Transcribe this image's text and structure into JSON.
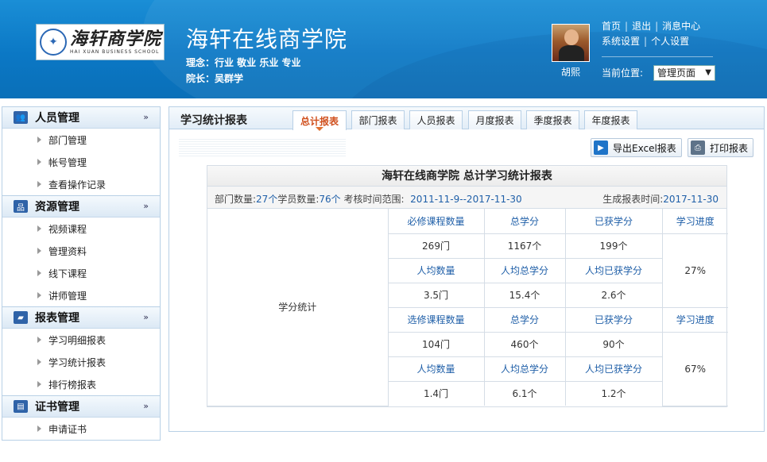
{
  "header": {
    "logo_cn": "海轩商学院",
    "logo_en": "HAI XUAN BUSINESS SCHOOL",
    "site_title": "海轩在线商学院",
    "motto": "理念：行业 敬业 乐业 专业",
    "dean": "院长：吴群学",
    "username": "胡熙",
    "links_row1": [
      "首页",
      "退出",
      "消息中心"
    ],
    "links_row2": [
      "系统设置",
      "个人设置"
    ],
    "position_label": "当前位置:",
    "position_value": "管理页面"
  },
  "sidebar": [
    {
      "title": "人员管理",
      "icon": "users-icon",
      "items": [
        "部门管理",
        "帐号管理",
        "查看操作记录"
      ]
    },
    {
      "title": "资源管理",
      "icon": "sitemap-icon",
      "items": [
        "视频课程",
        "管理资料",
        "线下课程",
        "讲师管理"
      ]
    },
    {
      "title": "报表管理",
      "icon": "folder-icon",
      "items": [
        "学习明细报表",
        "学习统计报表",
        "排行榜报表"
      ]
    },
    {
      "title": "证书管理",
      "icon": "certificate-icon",
      "items": [
        "申请证书"
      ]
    }
  ],
  "panel": {
    "title": "学习统计报表",
    "tabs": [
      "总计报表",
      "部门报表",
      "人员报表",
      "月度报表",
      "季度报表",
      "年度报表"
    ],
    "active_tab": 0,
    "export_label": "导出Excel报表",
    "print_label": "打印报表"
  },
  "report": {
    "title": "海轩在线商学院  总计学习统计报表",
    "dept_label": "部门数量:",
    "dept_value": "27个",
    "student_label": "学员数量:",
    "student_value": "76个",
    "range_label": "考核时间范围:",
    "range_value": "2011-11-9--2017-11-30",
    "gen_label": "生成报表时间:",
    "gen_value": "2017-11-30",
    "row_label": "学分统计",
    "required": {
      "h1": [
        "必修课程数量",
        "总学分",
        "已获学分"
      ],
      "v1": [
        "269门",
        "1167个",
        "199个"
      ],
      "h2": [
        "人均数量",
        "人均总学分",
        "人均已获学分"
      ],
      "v2": [
        "3.5门",
        "15.4个",
        "2.6个"
      ],
      "progress_label": "学习进度",
      "progress_value": "27%"
    },
    "elective": {
      "h1": [
        "选修课程数量",
        "总学分",
        "已获学分"
      ],
      "v1": [
        "104门",
        "460个",
        "90个"
      ],
      "h2": [
        "人均数量",
        "人均总学分",
        "人均已获学分"
      ],
      "v2": [
        "1.4门",
        "6.1个",
        "1.2个"
      ],
      "progress_label": "学习进度",
      "progress_value": "67%"
    }
  }
}
